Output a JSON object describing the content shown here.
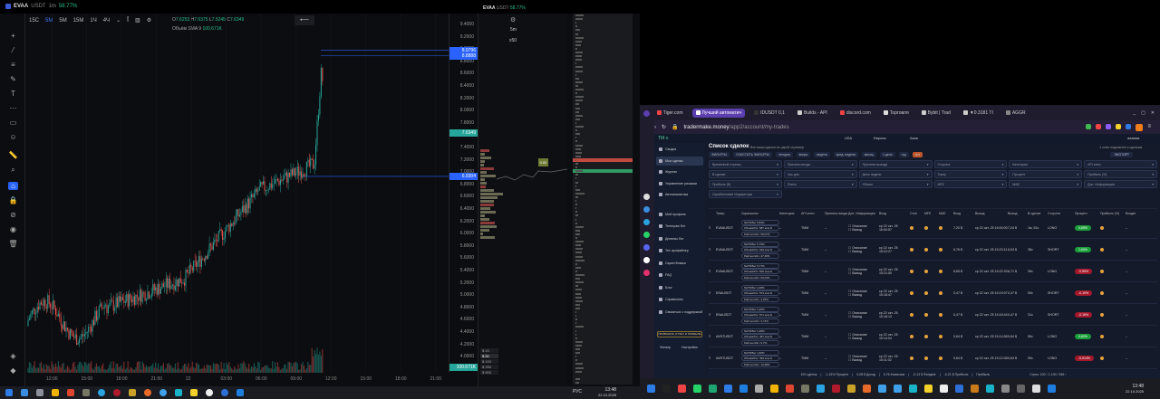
{
  "left": {
    "symbol": "EVAA",
    "quote": "USDT",
    "interval": "1m",
    "change": "58.77%",
    "intervals": [
      "15С",
      "5М",
      "5М",
      "15М",
      "1Ч",
      "4Ч"
    ],
    "active_interval": "5М",
    "ohlc": {
      "o": "7.6253",
      "h": "7.6375",
      "l": "7.5245",
      "c": "7.6349"
    },
    "volume_label": "Объём",
    "volume_sma": "SMA 9",
    "volume_value": "100.671K",
    "price_labels": [
      "9.4000",
      "9.2000",
      "9.0000",
      "8.8000",
      "8.6000",
      "8.4000",
      "8.2000",
      "8.0000",
      "7.8000",
      "7.4000",
      "7.2000",
      "7.0000",
      "6.8000",
      "6.6000",
      "6.4000",
      "6.2000",
      "6.0000",
      "5.8000",
      "5.6000",
      "5.4000",
      "5.2000",
      "5.0000",
      "4.8000",
      "4.6000",
      "4.4000",
      "4.2000",
      "4.0000"
    ],
    "price_tags": {
      "upper1": "8.9796",
      "upper2": "8.8888",
      "last": "7.6349",
      "lower": "6.9304"
    },
    "time_labels": [
      "12:00",
      "15:00",
      "18:00",
      "21:00",
      "22",
      "03:00",
      "06:00",
      "09:00",
      "12:00",
      "15:00",
      "18:00",
      "21:00"
    ],
    "mid_panel": {
      "symbol": "EVAA",
      "quote": "USDT",
      "change": "58.77%",
      "timeframe": "5m",
      "multiplier": "x50",
      "level_badge": "0.00",
      "buttons": [
        "$ 10",
        "$ 50",
        "$ 100",
        "$ 250",
        "$ 500"
      ]
    },
    "taskbar": {
      "lang": "РУС",
      "time": "13:48",
      "date": "22.10.2025"
    }
  },
  "browser": {
    "tabs": [
      "Tiger.com",
      "Лучший автоматич",
      "IDUSDT 0,1",
      "Builds - API",
      "discord.com",
      "Торговля",
      "Bybit | Trad",
      "▼0.3181 TI",
      "AGGR"
    ],
    "url_host": "tradermake.money",
    "url_path": "/app2/account/my-trades",
    "header": {
      "regions": [
        "USA",
        "Европа",
        "Азия"
      ],
      "user": "aaaaaa"
    },
    "sidebar": [
      "Сводка",
      "Мои сделки",
      "Журнал",
      "Управление рисками",
      "Автоаналитика",
      "Мой профиль",
      "Телеграм бот",
      "Дневник бот",
      "Тех профайлер",
      "Скриптбомжи",
      "FAQ",
      "Блог",
      "Справочник",
      "Связаться с поддержкой"
    ],
    "promo_button": "ПРИВЯЗАТЬ ОТЧЁТ И ПРИБЫЛЬ",
    "bottom_tools": [
      "Фильтр",
      "Настройки"
    ],
    "title": "Список сделок",
    "subtitle": "Все ваши сделки на одной странице",
    "top_right": "1 ключ подключен к сделкам",
    "filter_buttons": [
      "ФИЛЬТРЫ",
      "ОЧИСТИТЬ ФИЛЬТРЫ",
      "сегодня",
      "вчера",
      "неделя",
      "пред. неделя",
      "месяц",
      "1 день",
      "год",
      "всё"
    ],
    "export": "ЭКСПОРТ",
    "filters": [
      "Временной отрезок",
      "Причины входа",
      "Причины выхода",
      "Сторона",
      "Категория",
      "API ключ",
      "В сделке",
      "Час дня",
      "День недели",
      "Тикер",
      "Процент",
      "Прибыль (%)",
      "Прибыль ($)",
      "Плечо",
      "Объем",
      "MFE",
      "MAE",
      "Доп. Информация",
      "Скрабинговые Индикаторы"
    ],
    "columns": [
      "Тикер",
      "Скриншоты",
      "Категория",
      "API ключ",
      "Причины входа",
      "Доп. Информация",
      "Вход",
      "Стоп",
      "MFE",
      "MAE",
      "Вход",
      "Выход",
      "Выход",
      "В сделке",
      "Сторона",
      "Процент",
      "Прибыль (%)",
      "Входит"
    ],
    "trades": [
      {
        "ticker": "EVAAUSDT",
        "tags": [
          "NATR/5м: 5,84%",
          "Объём/24ч: 687 млн $",
          "Рейтинг/24ч: 58,07%"
        ],
        "api": "TMM",
        "entry_time": "ср 22 окт. 25 16:00:57",
        "entry": "7,20 $",
        "exit_time": "ср 22 окт. 25 16:00:00",
        "exit": "7,24 $",
        "duration": "1м, 51с",
        "side": "LONG",
        "pct": "0,65%",
        "pos": true
      },
      {
        "ticker": "EVAAUSDT",
        "tags": [
          "NATR/5м: 5,79%",
          "Объём/24ч: 633 млн $",
          "Рейтинг/24ч: 47,36%"
        ],
        "api": "TMM",
        "entry_time": "ср 22 окт. 25 15:22:27",
        "entry": "6,76 $",
        "exit_time": "ср 22 окт. 25 15:23:11",
        "exit": "6,63 $",
        "duration": "38с",
        "side": "SHORT",
        "pct": "1,60%",
        "pos": true
      },
      {
        "ticker": "EVAAUSDT",
        "tags": [
          "NATR/5м: 5,77%",
          "Объём/24ч: 600 млн $",
          "Рейтинг/24ч: 50,04%"
        ],
        "api": "TMM",
        "entry_time": "ср 22 окт. 25 15:21:55",
        "entry": "6,65 $",
        "exit_time": "ср 22 окт. 25 15:22:33",
        "exit": "6,71 $",
        "duration": "39с",
        "side": "LONG",
        "pct": "-0,55%",
        "pos": false
      },
      {
        "ticker": "ENAUSDT",
        "tags": [
          "NATR/5м: 1,08%",
          "Объём/24ч: 574 млн $",
          "Рейтинг/24ч: 3,25%"
        ],
        "api": "TMM",
        "entry_time": "ср 22 окт. 25 15:18:47",
        "entry": "0,47 $",
        "exit_time": "ср 22 окт. 25 15:19:07",
        "exit": "0,47 $",
        "duration": "59с",
        "side": "SHORT",
        "pct": "-0,19%",
        "pos": false
      },
      {
        "ticker": "ENAUSDT",
        "tags": [
          "NATR/5м: 1,20%",
          "Объём/24ч: 571 млн $",
          "Рейтинг/24ч: 4,74%"
        ],
        "api": "TMM",
        "entry_time": "ср 22 окт. 25 15:18:13",
        "entry": "0,47 $",
        "exit_time": "ср 22 окт. 25 15:18:44",
        "exit": "0,47 $",
        "duration": "31с",
        "side": "SHORT",
        "pct": "-0,15%",
        "pos": false
      },
      {
        "ticker": "AVNTUSDT",
        "tags": [
          "NATR/5м: 1,48%",
          "Объём/24ч: 497 млн $",
          "Рейтинг/24ч: 9,7%"
        ],
        "api": "TMM",
        "entry_time": "ср 22 окт. 25 15:14:04",
        "entry": "0,64 $",
        "exit_time": "ср 22 окт. 25 15:14:58",
        "exit": "0,64 $",
        "duration": "55с",
        "side": "LONG",
        "pct": "0,62%",
        "pos": true
      },
      {
        "ticker": "AVNTUSDT",
        "tags": [
          "NATR/5м: 1,60%",
          "Объём/24ч: 493 млн $",
          "Рейтинг/24ч: 10,68%"
        ],
        "api": "TMM",
        "entry_time": "ср 22 окт. 25 15:11:02",
        "entry": "0,64 $",
        "exit_time": "ср 22 окт. 25 15:12:08",
        "exit": "0,64 $",
        "duration": "39с",
        "side": "LONG",
        "pct": "-0,014%",
        "pos": false
      }
    ],
    "checkbox_labels": [
      "Описание",
      "Вывод"
    ],
    "footer": [
      "100 сделок",
      "-1,15% Процент",
      "0,08 $ Доход",
      "0,76 Комиссия",
      "-0,13 $ Фандинг",
      "-0,21 $ Прибыль",
      "Прибыль"
    ],
    "pagination": {
      "label": "Строк:",
      "rows": "100",
      "range": "1-100 / 946"
    },
    "taskbar": {
      "time": "13:48",
      "date": "22.10.2025"
    }
  },
  "colors": {
    "up": "#26a69a",
    "down": "#ef5350",
    "accent": "#2962ff",
    "pos": "#1a9e3a",
    "neg": "#a3182a"
  }
}
